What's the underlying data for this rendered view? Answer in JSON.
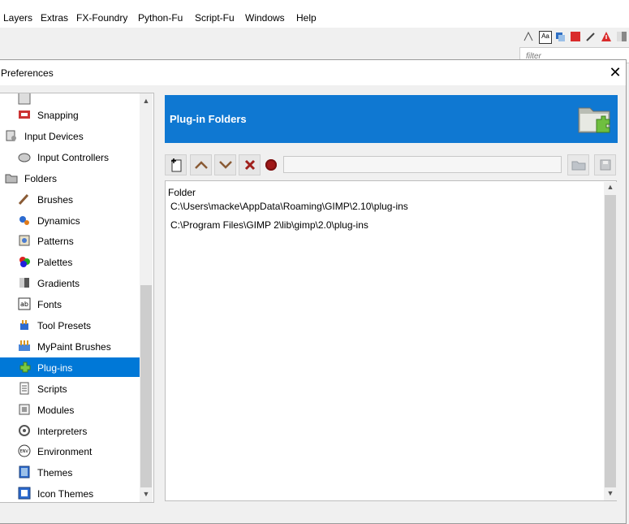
{
  "menubar": {
    "items": [
      "Layers",
      "Extras",
      "FX-Foundry",
      "Python-Fu",
      "Script-Fu",
      "Windows",
      "Help"
    ]
  },
  "dock": {
    "filter_placeholder": "filter"
  },
  "dialog": {
    "title": "Preferences",
    "close_label": "✕"
  },
  "sidebar": {
    "items": [
      {
        "label": "Snapping",
        "icon": "snapping-icon",
        "indent": 1
      },
      {
        "label": "Input Devices",
        "icon": "input-devices-icon",
        "indent": 0
      },
      {
        "label": "Input Controllers",
        "icon": "input-controllers-icon",
        "indent": 1
      },
      {
        "label": "Folders",
        "icon": "folders-icon",
        "indent": 0
      },
      {
        "label": "Brushes",
        "icon": "brushes-icon",
        "indent": 1
      },
      {
        "label": "Dynamics",
        "icon": "dynamics-icon",
        "indent": 1
      },
      {
        "label": "Patterns",
        "icon": "patterns-icon",
        "indent": 1
      },
      {
        "label": "Palettes",
        "icon": "palettes-icon",
        "indent": 1
      },
      {
        "label": "Gradients",
        "icon": "gradients-icon",
        "indent": 1
      },
      {
        "label": "Fonts",
        "icon": "fonts-icon",
        "indent": 1
      },
      {
        "label": "Tool Presets",
        "icon": "tool-presets-icon",
        "indent": 1
      },
      {
        "label": "MyPaint Brushes",
        "icon": "mypaint-brushes-icon",
        "indent": 1
      },
      {
        "label": "Plug-ins",
        "icon": "plug-ins-icon",
        "indent": 1,
        "selected": true
      },
      {
        "label": "Scripts",
        "icon": "scripts-icon",
        "indent": 1
      },
      {
        "label": "Modules",
        "icon": "modules-icon",
        "indent": 1
      },
      {
        "label": "Interpreters",
        "icon": "interpreters-icon",
        "indent": 1
      },
      {
        "label": "Environment",
        "icon": "environment-icon",
        "indent": 1
      },
      {
        "label": "Themes",
        "icon": "themes-icon",
        "indent": 1
      },
      {
        "label": "Icon Themes",
        "icon": "icon-themes-icon",
        "indent": 1
      }
    ]
  },
  "page": {
    "heading": "Plug-in Folders",
    "accent_color": "#0f78d2",
    "toolbar": {
      "new": "new-folder-icon",
      "up": "move-up-icon",
      "down": "move-down-icon",
      "delete": "delete-icon",
      "writable": "writable-toggle-icon",
      "path_value": ""
    },
    "list": {
      "column": "Folder",
      "rows": [
        "C:\\Users\\macke\\AppData\\Roaming\\GIMP\\2.10\\plug-ins",
        "C:\\Program Files\\GIMP 2\\lib\\gimp\\2.0\\plug-ins"
      ]
    }
  }
}
